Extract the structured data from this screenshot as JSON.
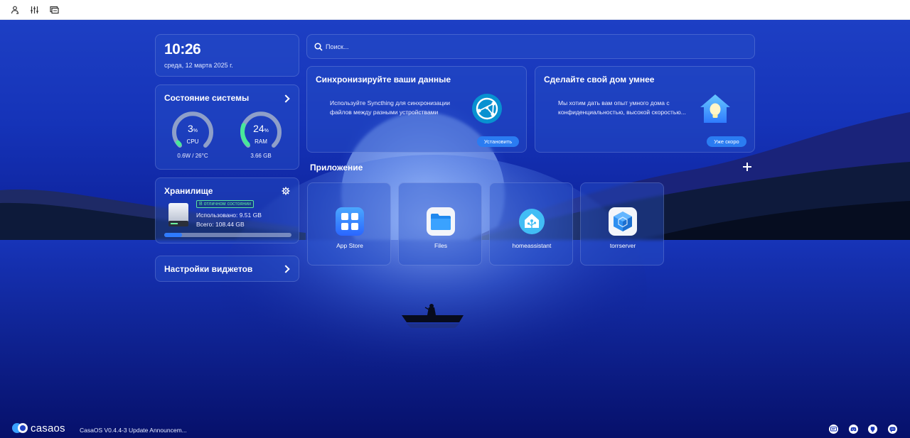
{
  "topbar": {
    "icons": [
      "user-icon",
      "sliders-icon",
      "monitor-icon"
    ]
  },
  "clock": {
    "time": "10:26",
    "date": "среда, 12 марта 2025 г."
  },
  "system_status": {
    "title": "Состояние системы",
    "cpu": {
      "value": "3",
      "unit": "%",
      "label": "CPU",
      "sub": "0.6W / 26°C",
      "percent": 3
    },
    "ram": {
      "value": "24",
      "unit": "%",
      "label": "RAM",
      "sub": "3.66 GB",
      "percent": 24
    }
  },
  "storage": {
    "title": "Хранилище",
    "badge": "В отличном состоянии",
    "used": "Использовано: 9.51 GB",
    "total": "Всего: 108.44 GB",
    "percent": 9
  },
  "widgets_settings": {
    "label": "Настройки виджетов"
  },
  "search": {
    "placeholder": "Поиск..."
  },
  "promos": [
    {
      "title": "Синхронизируйте ваши данные",
      "desc": "Используйте Syncthing для синхронизации файлов между разными устройствами",
      "button": "Установить",
      "icon": "syncthing-icon"
    },
    {
      "title": "Сделайте свой дом умнее",
      "desc": "Мы хотим дать вам опыт умного дома с конфиденциальностью, высокой скоростью...",
      "button": "Уже скоро",
      "icon": "smart-home-icon"
    }
  ],
  "apps": {
    "title": "Приложение",
    "items": [
      {
        "name": "App Store",
        "icon": "app-store-icon"
      },
      {
        "name": "Files",
        "icon": "folder-icon"
      },
      {
        "name": "homeassistant",
        "icon": "home-assistant-icon"
      },
      {
        "name": "torrserver",
        "icon": "torrserver-icon"
      }
    ]
  },
  "footer": {
    "logo": "casaos",
    "announcement": "CasaOS V0.4.4-3 Update Announcem...",
    "social": [
      "forum-icon",
      "discord-icon",
      "github-icon",
      "chat-icon"
    ]
  },
  "colors": {
    "accent": "#2a7cf2",
    "gauge_track": "#8e9fc9",
    "gauge_fill": "#48e89a",
    "healthy": "#5be6a0"
  }
}
